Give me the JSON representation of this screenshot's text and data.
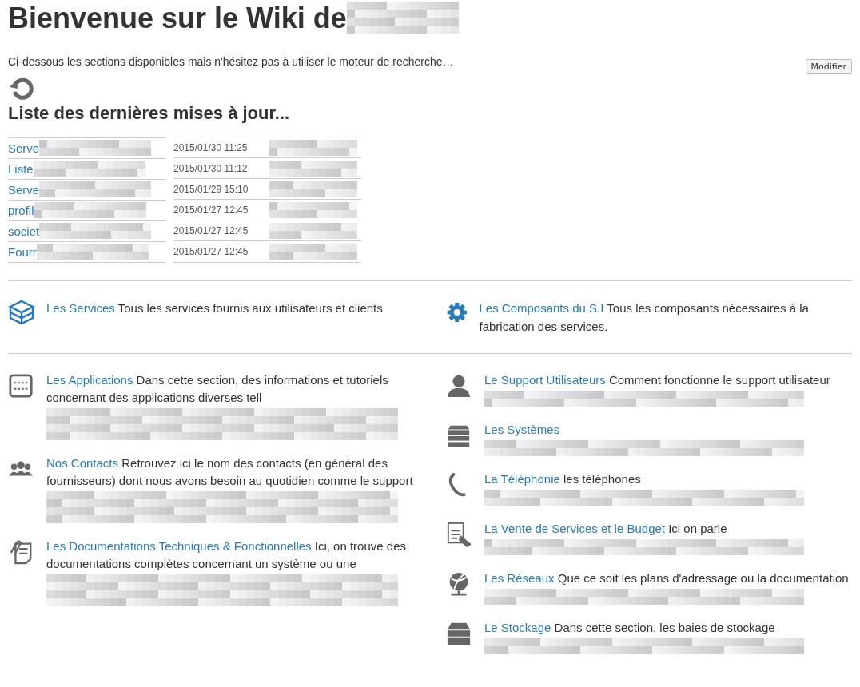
{
  "page": {
    "title": "Bienvenue sur le Wiki de",
    "title_redacted": true,
    "intro": "Ci-dessous les sections disponibles mais n'hésitez pas à utiliser le moteur de recherche…",
    "edit_button": "Modifier"
  },
  "updates": {
    "heading": "Liste des dernières mises à jour...",
    "rows": [
      {
        "page": "Serve",
        "date": "2015/01/30 11:25",
        "redacted": true
      },
      {
        "page": "Liste",
        "date": "2015/01/30 11:12",
        "redacted": true
      },
      {
        "page": "Serve",
        "date": "2015/01/29 15:10",
        "redacted": true
      },
      {
        "page": "profil",
        "date": "2015/01/27 12:45",
        "redacted": true
      },
      {
        "page": "societ",
        "date": "2015/01/27 12:45",
        "redacted": true
      },
      {
        "page": "Fourr",
        "date": "2015/01/27 12:45",
        "redacted": true
      }
    ]
  },
  "sections_top": [
    {
      "link": "Les Services",
      "text": "Tous les services fournis aux utilisateurs et clients"
    },
    {
      "link": "Les Composants du S.I",
      "text": "Tous les composants nécessaires à la fabrication des services."
    }
  ],
  "sections_left": [
    {
      "link": "Les Applications",
      "text": "Dans cette section, des informations et tutoriels concernant des applications diverses tell",
      "redacted": true
    },
    {
      "link": "Nos Contacts",
      "text": "Retrouvez ici le nom des contacts (en général des fournisseurs) dont nous avons besoin au quotidien comme le support",
      "redacted": true
    },
    {
      "link": "Les Documentations Techniques & Fonctionnelles",
      "text": "Ici, on trouve des documentations complètes concernant un système ou une",
      "redacted": true
    }
  ],
  "sections_right": [
    {
      "link": "Le Support Utilisateurs",
      "text": "Comment fonctionne le support utilisateur",
      "redacted": true
    },
    {
      "link": "Les Systèmes",
      "redacted": true
    },
    {
      "link": "La Téléphonie",
      "text": "les téléphones",
      "redacted": true
    },
    {
      "link": "La Vente de Services et le Budget",
      "text": "Ici on parle",
      "redacted": true
    },
    {
      "link": "Les Réseaux",
      "text": "Que ce soit les plans d'adressage ou la documentation",
      "redacted": true
    },
    {
      "link": "Le Stockage",
      "text": "Dans cette section, les baies de stockage",
      "redacted": true
    }
  ]
}
